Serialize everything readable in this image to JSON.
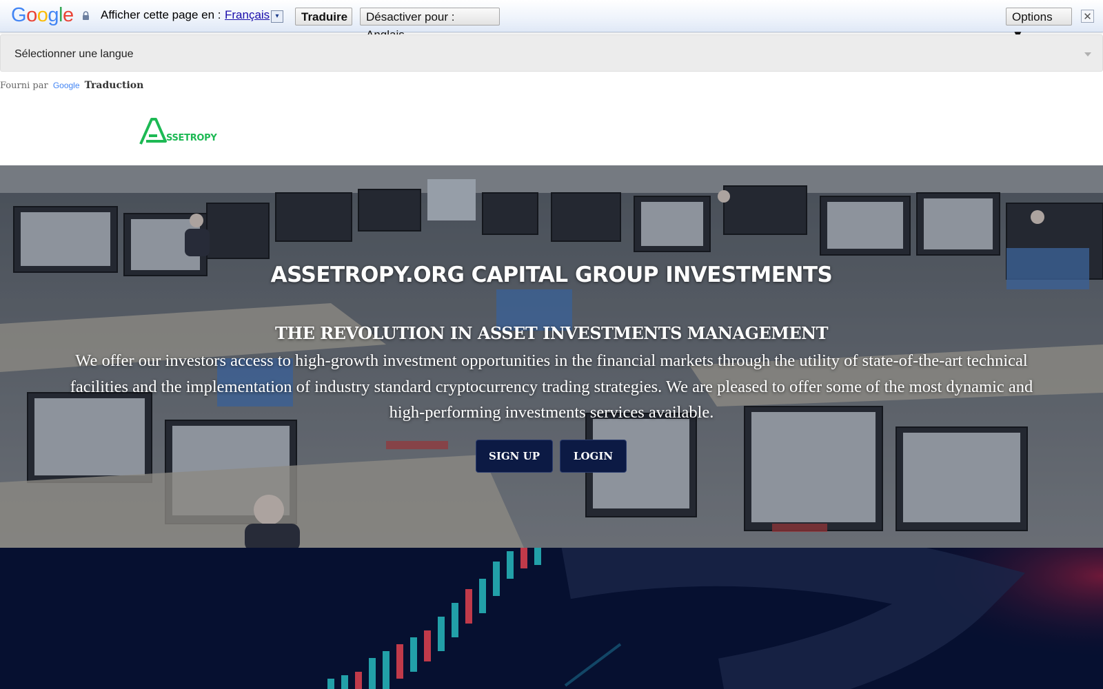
{
  "translate_bar": {
    "google_logo": "Google",
    "prompt": "Afficher cette page en :",
    "language": "Français",
    "dropdown_glyph": "▾",
    "translate_button": "Traduire",
    "disable_button": "Désactiver pour : Anglais",
    "options_button": "Options ▼",
    "close_glyph": "✕"
  },
  "language_select": {
    "label": "Sélectionner une langue"
  },
  "powered_by": {
    "prefix": "Fourni par",
    "google": "Google",
    "product": "Traduction"
  },
  "site": {
    "logo_text": "SSETROPY",
    "brand_color": "#1db954"
  },
  "hero": {
    "title": "ASSETROPY.ORG CAPITAL GROUP INVESTMENTS",
    "subtitle": "THE REVOLUTION IN ASSET INVESTMENTS MANAGEMENT",
    "body": "We offer our investors access to high-growth investment opportunities in the financial markets through the utility of state-of-the-art technical facilities and the implementation of industry standard cryptocurrency trading strategies. We are pleased to offer some of the most dynamic and high-performing investments services available.",
    "signup_label": "SIGN UP",
    "login_label": "LOGIN"
  }
}
